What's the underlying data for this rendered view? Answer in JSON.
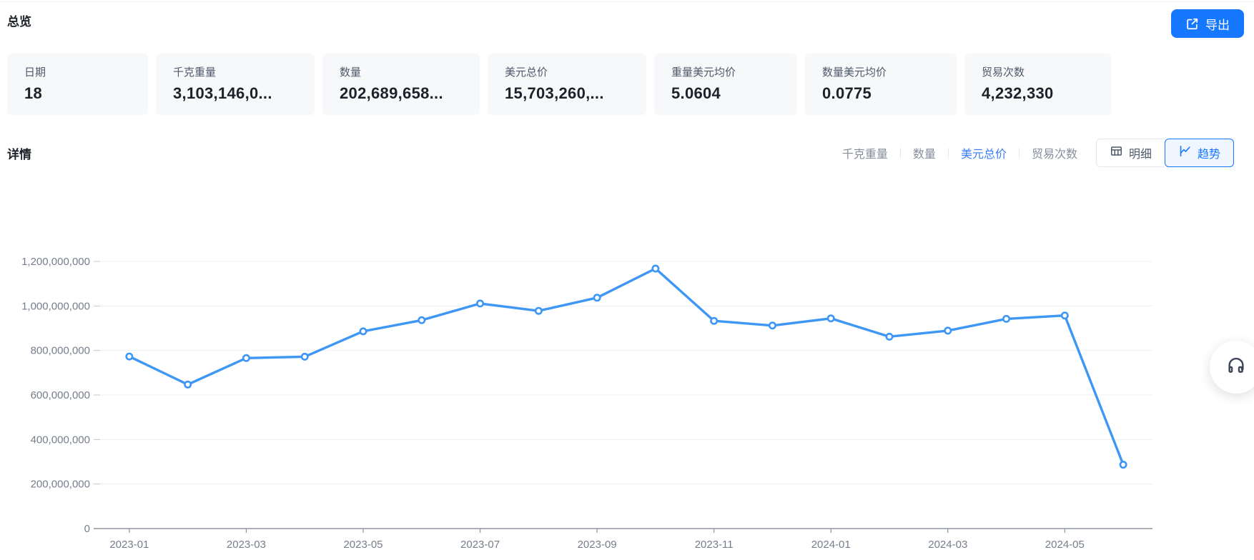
{
  "page": {
    "title": "总览",
    "details_title": "详情"
  },
  "export_button": {
    "label": "导出"
  },
  "stat_cards": [
    {
      "label": "日期",
      "value": "18"
    },
    {
      "label": "千克重量",
      "value": "3,103,146,0..."
    },
    {
      "label": "数量",
      "value": "202,689,658..."
    },
    {
      "label": "美元总价",
      "value": "15,703,260,..."
    },
    {
      "label": "重量美元均价",
      "value": "5.0604"
    },
    {
      "label": "数量美元均价",
      "value": "0.0775"
    },
    {
      "label": "贸易次数",
      "value": "4,232,330"
    }
  ],
  "metric_tabs": [
    {
      "label": "千克重量",
      "active": false
    },
    {
      "label": "数量",
      "active": false
    },
    {
      "label": "美元总价",
      "active": true
    },
    {
      "label": "贸易次数",
      "active": false
    }
  ],
  "view_toggle": {
    "detail_label": "明细",
    "trend_label": "趋势",
    "active": "趋势"
  },
  "colors": {
    "accent_blue": "#1677ff",
    "active_tab_blue": "#3b7df7",
    "trend_button_bg": "#f0f6ff",
    "card_bg": "#f7f8fa",
    "text_primary": "#1d2129",
    "text_secondary": "#4e5969",
    "tab_inactive": "#878e9c",
    "border": "#e5e6eb"
  },
  "chart_data": {
    "type": "line",
    "title": "",
    "xlabel": "",
    "ylabel": "",
    "x": [
      "2023-01",
      "2023-02",
      "2023-03",
      "2023-04",
      "2023-05",
      "2023-06",
      "2023-07",
      "2023-08",
      "2023-09",
      "2023-10",
      "2023-11",
      "2023-12",
      "2024-01",
      "2024-02",
      "2024-03",
      "2024-04",
      "2024-05",
      "2024-06"
    ],
    "series": [
      {
        "name": "美元总价",
        "values": [
          773000000,
          647000000,
          766000000,
          772000000,
          886000000,
          936000000,
          1011000000,
          978000000,
          1037000000,
          1168000000,
          933000000,
          912000000,
          944000000,
          862000000,
          889000000,
          942000000,
          957000000,
          287000000
        ]
      }
    ],
    "ylim": [
      0,
      1200000000
    ],
    "yticks": [
      0,
      200000000,
      400000000,
      600000000,
      800000000,
      1000000000,
      1200000000
    ],
    "x_label_interval": 2,
    "grid": true,
    "legend": false,
    "line_color": "#3e96f5",
    "marker": "circle-open",
    "grid_color": "#eef0f6",
    "axis_line_color": "#8f959e",
    "axis_tick_color": "#c2c7cf",
    "axis_label_color": "#767e8b"
  }
}
